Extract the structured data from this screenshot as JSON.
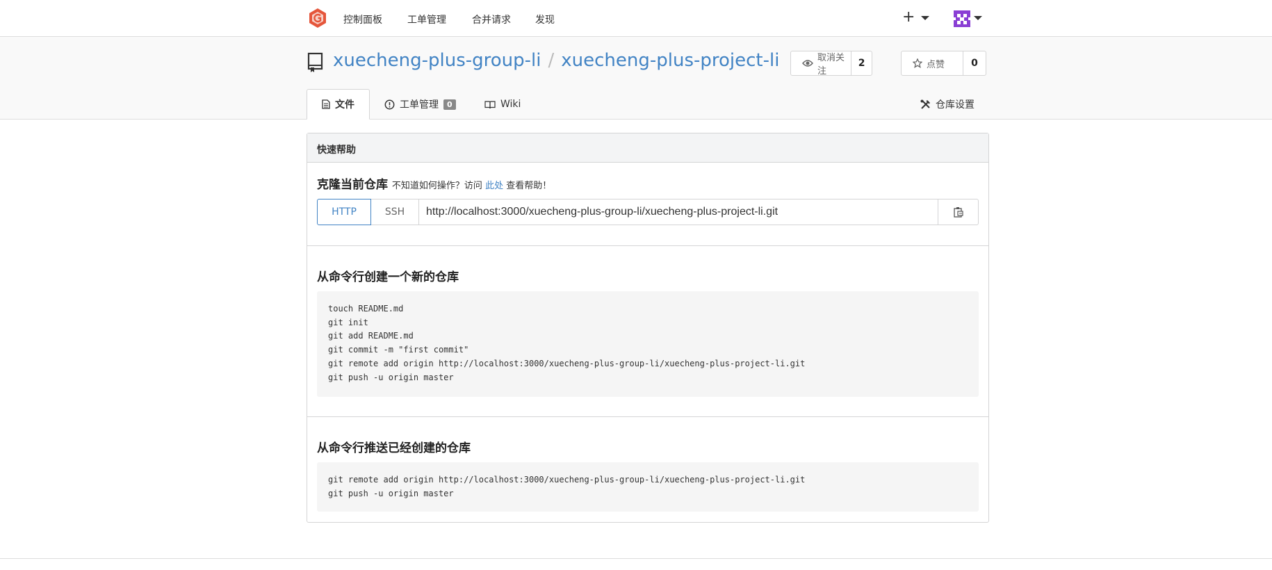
{
  "nav": {
    "items": [
      "控制面板",
      "工单管理",
      "合并请求",
      "发现"
    ],
    "create_label": "+"
  },
  "repo": {
    "owner": "xuecheng-plus-group-li",
    "separator": "/",
    "name": "xuecheng-plus-project-li",
    "watch_label": "取消关注",
    "watch_count": "2",
    "star_label": "点赞",
    "star_count": "0"
  },
  "tabs": {
    "files": "文件",
    "issues": "工单管理",
    "issues_count": "0",
    "wiki": "Wiki",
    "settings": "仓库设置"
  },
  "quick_help": {
    "title": "快速帮助",
    "clone_title": "克隆当前仓库",
    "help_prefix": "不知道如何操作？访问",
    "help_link": "此处",
    "help_suffix": "查看帮助！",
    "http_label": "HTTP",
    "ssh_label": "SSH",
    "clone_url": "http://localhost:3000/xuecheng-plus-group-li/xuecheng-plus-project-li.git"
  },
  "new_repo": {
    "title": "从命令行创建一个新的仓库",
    "code": "touch README.md\ngit init\ngit add README.md\ngit commit -m \"first commit\"\ngit remote add origin http://localhost:3000/xuecheng-plus-group-li/xuecheng-plus-project-li.git\ngit push -u origin master"
  },
  "push_existing": {
    "title": "从命令行推送已经创建的仓库",
    "code": "git remote add origin http://localhost:3000/xuecheng-plus-group-li/xuecheng-plus-project-li.git\ngit push -u origin master"
  },
  "colors": {
    "accent": "#4183c4",
    "logo": "#e5563b"
  }
}
